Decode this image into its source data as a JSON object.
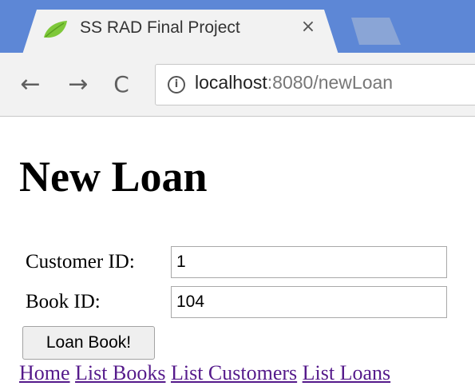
{
  "browser": {
    "tab": {
      "title": "SS RAD Final Project",
      "close_glyph": "×",
      "favicon": "leaf-icon"
    },
    "nav": {
      "back_glyph": "←",
      "forward_glyph": "→",
      "reload_glyph": "C"
    },
    "address": {
      "info_glyph": "i",
      "host": "localhost",
      "rest": ":8080/newLoan"
    },
    "colors": {
      "tabstrip": "#5d87d6",
      "favicon": "#7ec83a"
    }
  },
  "page": {
    "title": "New Loan",
    "form": {
      "customer_label": "Customer ID:",
      "customer_value": "1",
      "book_label": "Book ID:",
      "book_value": "104",
      "submit_label": "Loan Book!"
    },
    "links": {
      "home": "Home",
      "list_books": "List Books",
      "list_customers": "List Customers",
      "list_loans": "List Loans"
    },
    "colors": {
      "visited_link": "#551a8b"
    }
  }
}
